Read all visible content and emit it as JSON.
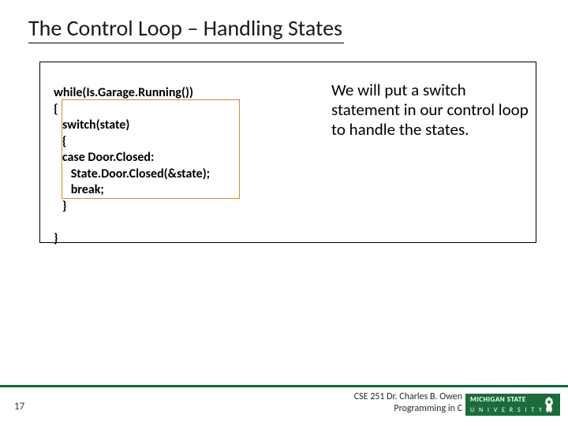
{
  "title": "The Control Loop – Handling States",
  "code": {
    "l1": "while(Is.Garage.Running())",
    "l2": "{",
    "l3": "   switch(state)",
    "l4": "   {",
    "l5": "   case Door.Closed:",
    "l6": "      State.Door.Closed(&state);",
    "l7": "      break;",
    "l8": "   }",
    "l9": "",
    "l10": "}"
  },
  "description": "We will put a switch statement in our control loop to handle the states.",
  "page_number": "17",
  "footer": {
    "line1": "CSE 251 Dr. Charles B. Owen",
    "line2": "Programming in C"
  },
  "logo": {
    "top": "MICHIGAN STATE",
    "bottom": "U N I V E R S I T Y"
  },
  "colors": {
    "accent_green": "#1a6d3b",
    "highlight_orange": "#d88b2a"
  }
}
